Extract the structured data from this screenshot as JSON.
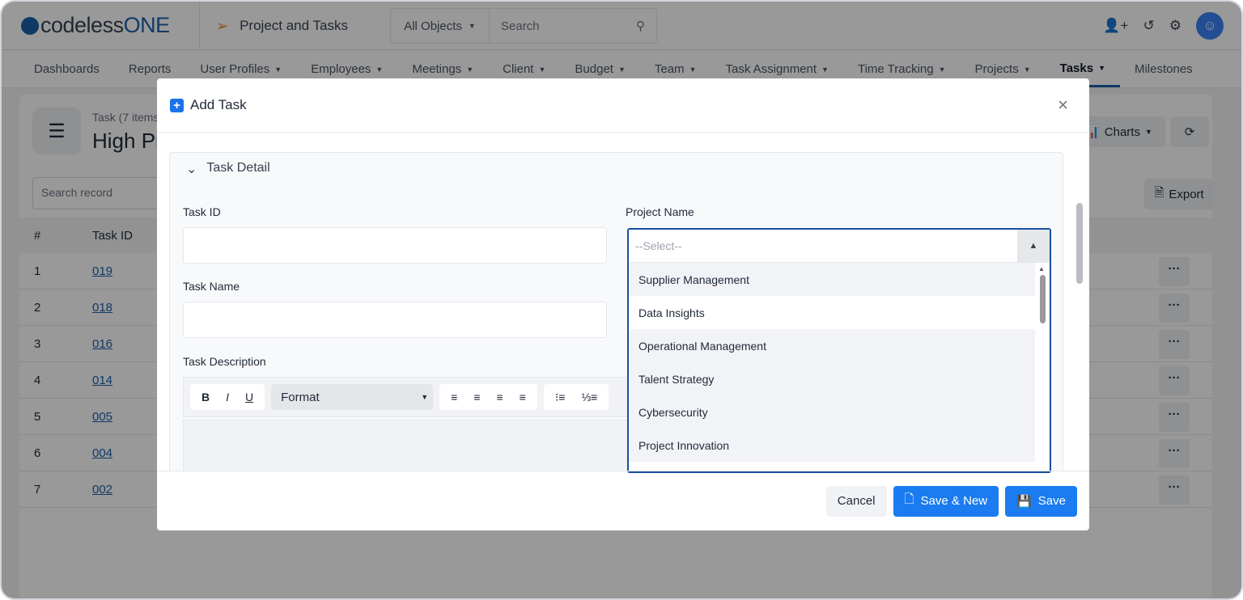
{
  "app": {
    "logo": "codelessONE",
    "title": "Project and Tasks",
    "search_scope": "All Objects",
    "search_placeholder": "Search"
  },
  "nav": [
    {
      "label": "Dashboards"
    },
    {
      "label": "Reports"
    },
    {
      "label": "User Profiles",
      "dd": true
    },
    {
      "label": "Employees",
      "dd": true
    },
    {
      "label": "Meetings",
      "dd": true
    },
    {
      "label": "Client",
      "dd": true
    },
    {
      "label": "Budget",
      "dd": true
    },
    {
      "label": "Team",
      "dd": true
    },
    {
      "label": "Task Assignment",
      "dd": true
    },
    {
      "label": "Time Tracking",
      "dd": true
    },
    {
      "label": "Projects",
      "dd": true
    },
    {
      "label": "Tasks",
      "dd": true,
      "active": true
    },
    {
      "label": "Milestones"
    }
  ],
  "page": {
    "subtitle": "Task (7 items",
    "title": "High Pr",
    "search_placeholder": "Search record",
    "charts": "Charts",
    "export": "Export",
    "columns": [
      "#",
      "Task ID"
    ],
    "rows": [
      {
        "n": "1",
        "id": "019"
      },
      {
        "n": "2",
        "id": "018"
      },
      {
        "n": "3",
        "id": "016"
      },
      {
        "n": "4",
        "id": "014"
      },
      {
        "n": "5",
        "id": "005"
      },
      {
        "n": "6",
        "id": "004"
      },
      {
        "n": "7",
        "id": "002"
      }
    ],
    "more": "···"
  },
  "modal": {
    "title": "Add Task",
    "section": "Task Detail",
    "task_id_label": "Task ID",
    "task_name_label": "Task Name",
    "task_desc_label": "Task Description",
    "project_label": "Project Name",
    "editor": {
      "bold": "B",
      "italic": "I",
      "underline": "U",
      "format": "Format"
    },
    "dropdown": {
      "placeholder": "--Select--",
      "options": [
        "Supplier Management",
        "Data Insights",
        "Operational Management",
        "Talent Strategy",
        "Cybersecurity",
        "Project Innovation"
      ]
    },
    "cancel": "Cancel",
    "save_new": "Save & New",
    "save": "Save"
  },
  "colors": {
    "primary": "#1a7cf0",
    "brand": "#1d5fa8",
    "dropdown_border": "#1a4fa0"
  }
}
